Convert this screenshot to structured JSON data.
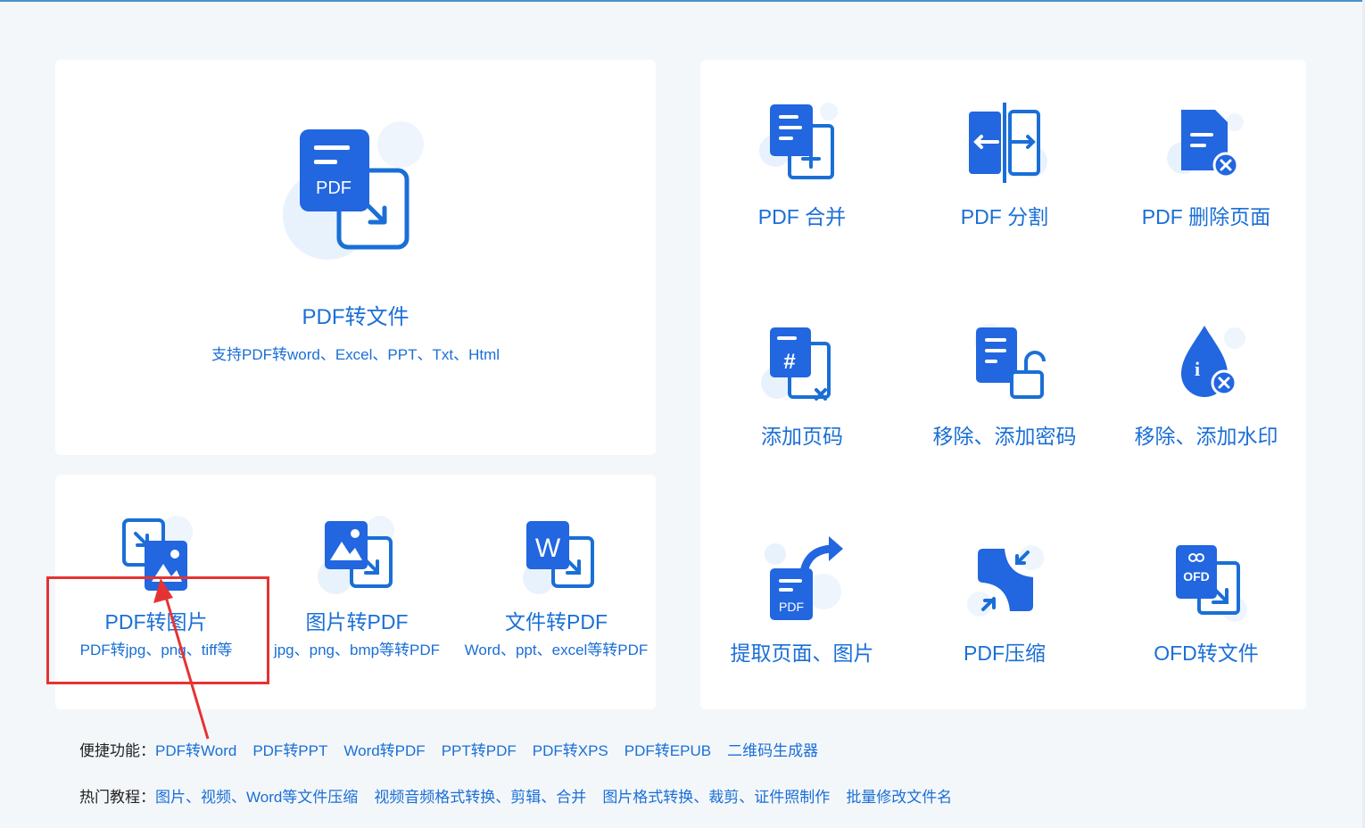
{
  "main_card": {
    "title": "PDF转文件",
    "subtitle": "支持PDF转word、Excel、PPT、Txt、Html",
    "icon_text": "PDF"
  },
  "convert_card": {
    "items": [
      {
        "title": "PDF转图片",
        "subtitle": "PDF转jpg、png、tiff等"
      },
      {
        "title": "图片转PDF",
        "subtitle": "jpg、png、bmp等转PDF"
      },
      {
        "title": "文件转PDF",
        "subtitle": "Word、ppt、excel等转PDF",
        "icon_text": "W"
      }
    ]
  },
  "tools": [
    {
      "label": "PDF 合并",
      "icon": "pdf-merge-icon"
    },
    {
      "label": "PDF 分割",
      "icon": "pdf-split-icon"
    },
    {
      "label": "PDF 删除页面",
      "icon": "pdf-delete-page-icon"
    },
    {
      "label": "添加页码",
      "icon": "page-number-icon",
      "icon_text": "#"
    },
    {
      "label": "移除、添加密码",
      "icon": "password-lock-icon"
    },
    {
      "label": "移除、添加水印",
      "icon": "watermark-drop-icon",
      "icon_text": "i"
    },
    {
      "label": "提取页面、图片",
      "icon": "extract-page-icon",
      "icon_text": "PDF"
    },
    {
      "label": "PDF压缩",
      "icon": "pdf-compress-icon"
    },
    {
      "label": "OFD转文件",
      "icon": "ofd-convert-icon",
      "icon_text": "OFD"
    }
  ],
  "quick_links": {
    "label": "便捷功能：",
    "items": [
      "PDF转Word",
      "PDF转PPT",
      "Word转PDF",
      "PPT转PDF",
      "PDF转XPS",
      "PDF转EPUB",
      "二维码生成器"
    ]
  },
  "tutorials": {
    "label": "热门教程：",
    "items": [
      "图片、视频、Word等文件压缩",
      "视频音频格式转换、剪辑、合并",
      "图片格式转换、裁剪、证件照制作",
      "批量修改文件名"
    ]
  },
  "colors": {
    "accent": "#1a6fd6",
    "annotation": "#e53333",
    "background": "#f4f7fa",
    "card": "#ffffff"
  }
}
